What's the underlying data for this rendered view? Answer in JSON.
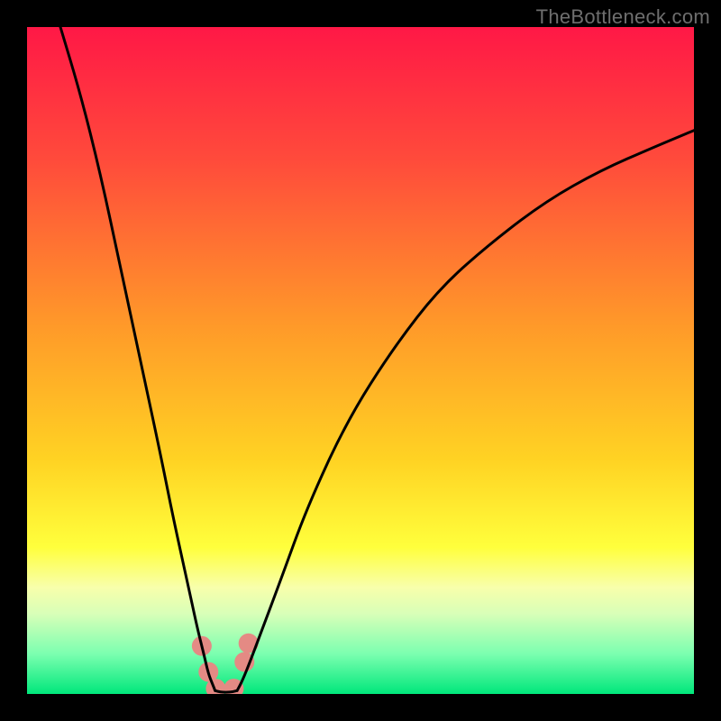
{
  "watermark": "TheBottleneck.com",
  "chart_data": {
    "type": "line",
    "title": "",
    "xlabel": "",
    "ylabel": "",
    "xlim": [
      0,
      100
    ],
    "ylim": [
      0,
      100
    ],
    "grid": false,
    "legend": false,
    "gradient_stops": [
      {
        "offset": 0,
        "color": "#ff1846"
      },
      {
        "offset": 20,
        "color": "#ff4b3b"
      },
      {
        "offset": 45,
        "color": "#ff9a29"
      },
      {
        "offset": 65,
        "color": "#ffd323"
      },
      {
        "offset": 78,
        "color": "#ffff3c"
      },
      {
        "offset": 84,
        "color": "#f8ffab"
      },
      {
        "offset": 88,
        "color": "#d8ffb8"
      },
      {
        "offset": 94,
        "color": "#7bffb0"
      },
      {
        "offset": 100,
        "color": "#00e77b"
      }
    ],
    "series": [
      {
        "name": "left-branch",
        "x": [
          5,
          8,
          11,
          14,
          17,
          20,
          22,
          24,
          25.5,
          26.5,
          27.2,
          27.8,
          28.2
        ],
        "values": [
          100,
          90,
          78,
          64,
          50,
          36,
          26,
          17,
          10,
          6,
          3,
          1.5,
          0.5
        ]
      },
      {
        "name": "right-branch",
        "x": [
          31.5,
          32.3,
          33.5,
          35,
          38,
          42,
          48,
          55,
          62,
          70,
          78,
          86,
          94,
          100
        ],
        "values": [
          0.5,
          2,
          5,
          9,
          17,
          28,
          41,
          52,
          61,
          68,
          74,
          78.5,
          82,
          84.5
        ]
      }
    ],
    "scatter": {
      "name": "dots",
      "points": [
        {
          "x": 26.2,
          "y": 7.2
        },
        {
          "x": 27.2,
          "y": 3.3
        },
        {
          "x": 28.3,
          "y": 0.8
        },
        {
          "x": 31.0,
          "y": 0.8
        },
        {
          "x": 32.6,
          "y": 4.8
        },
        {
          "x": 33.2,
          "y": 7.6
        }
      ],
      "color": "#e48a84",
      "radius": 11
    },
    "curve_min": {
      "x": 29.8,
      "y": 0
    }
  }
}
